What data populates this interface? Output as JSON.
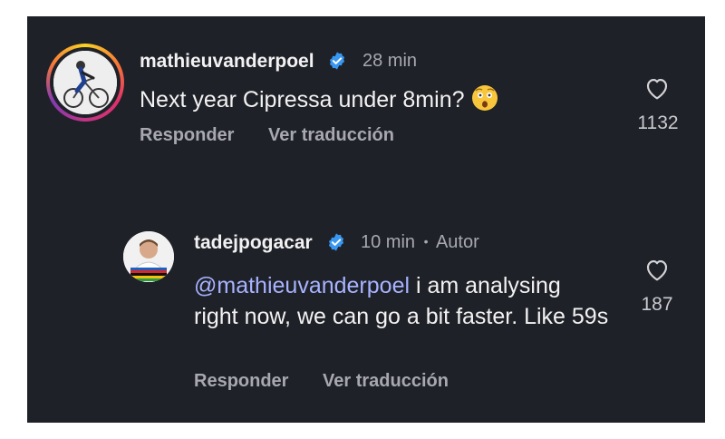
{
  "comments": [
    {
      "username": "mathieuvanderpoel",
      "time": "28 min",
      "text": "Next year Cipressa under 8min?",
      "reply_label": "Responder",
      "translate_label": "Ver traducción",
      "likes": "1132",
      "icons": [
        "verified-badge-icon",
        "shocked-face-emoji-icon",
        "heart-icon"
      ]
    },
    {
      "username": "tadejpogacar",
      "time": "10 min",
      "separator": "•",
      "author_label": "Autor",
      "mention": "@mathieuvanderpoel",
      "text": " i am analysing right now, we can go a bit faster. Like 59s",
      "reply_label": "Responder",
      "translate_label": "Ver traducción",
      "likes": "187",
      "icons": [
        "verified-badge-icon",
        "heart-icon"
      ]
    }
  ],
  "colors": {
    "background": "#1f2128",
    "text": "#f2f2f2",
    "muted": "#a8a8b0",
    "mention": "#a7b3ff",
    "verified": "#3897f0"
  }
}
